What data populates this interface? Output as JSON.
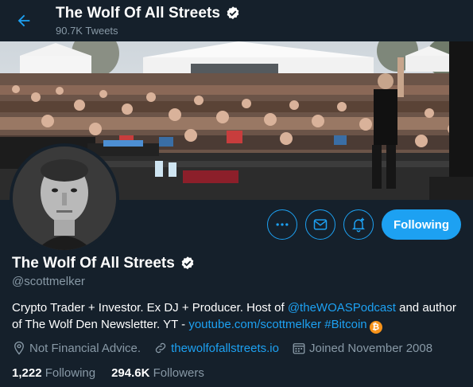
{
  "header": {
    "back_icon": "arrow-left-icon",
    "title": "The Wolf Of All Streets",
    "tweet_count": "90.7K Tweets",
    "verified_icon": "verified-badge-icon"
  },
  "banner": {
    "description_icon": "concert-crowd-photo"
  },
  "avatar": {
    "icon": "profile-photo"
  },
  "actions": {
    "more_icon": "more-dots-icon",
    "message_icon": "mail-icon",
    "notify_icon": "bell-plus-icon",
    "following_label": "Following"
  },
  "profile": {
    "name": "The Wolf Of All Streets",
    "handle": "@scottmelker",
    "bio": {
      "part1": "Crypto Trader + Investor. Ex DJ + Producer. Host of ",
      "mention": "@theWOASPodcast",
      "part2": " and author of The Wolf Den Newsletter. YT - ",
      "youtube_link": "youtube.com/scottmelker",
      "space": " ",
      "hashtag": "#Bitcoin",
      "emoji": "₿"
    },
    "location": "Not Financial Advice.",
    "website": "thewolfofallstreets.io",
    "joined": "Joined November 2008"
  },
  "stats": {
    "following_count": "1,222",
    "following_label": "Following",
    "followers_count": "294.6K",
    "followers_label": "Followers"
  },
  "colors": {
    "background": "#15202b",
    "accent": "#1da1f2",
    "muted": "#8899a6",
    "bitcoin": "#f7931a"
  }
}
